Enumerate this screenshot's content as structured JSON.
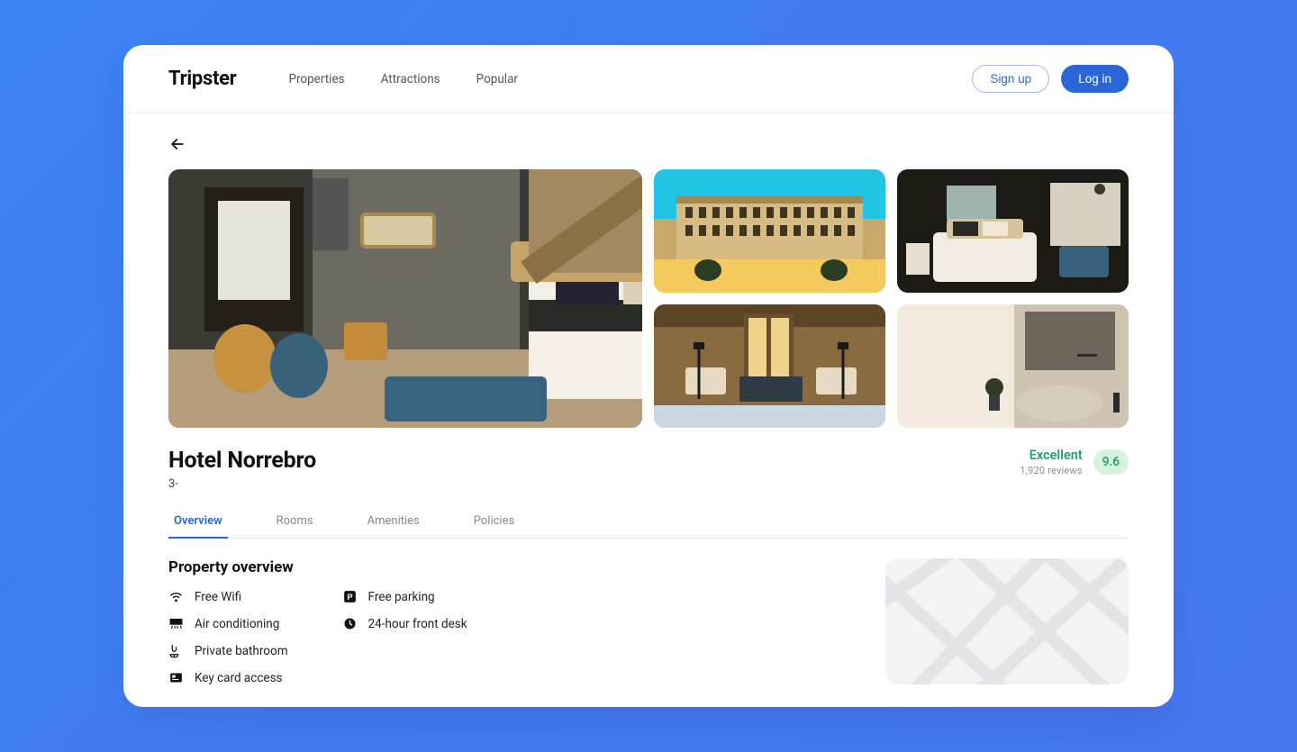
{
  "brand": "Tripster",
  "nav": {
    "properties": "Properties",
    "attractions": "Attractions",
    "popular": "Popular"
  },
  "auth": {
    "signup": "Sign up",
    "login": "Log in"
  },
  "hotel": {
    "name": "Hotel Norrebro",
    "sub": "3-",
    "rating": {
      "label": "Excellent",
      "reviews": "1,920 reviews",
      "score": "9.6"
    }
  },
  "tabs": {
    "overview": "Overview",
    "rooms": "Rooms",
    "amenities": "Amenities",
    "policies": "Policies"
  },
  "overview": {
    "title": "Property overview",
    "col1": {
      "a": "Free Wifi",
      "b": "Air conditioning",
      "c": "Private bathroom",
      "d": "Key card access"
    },
    "col2": {
      "a": "Free parking",
      "b": "24-hour front desk"
    }
  }
}
